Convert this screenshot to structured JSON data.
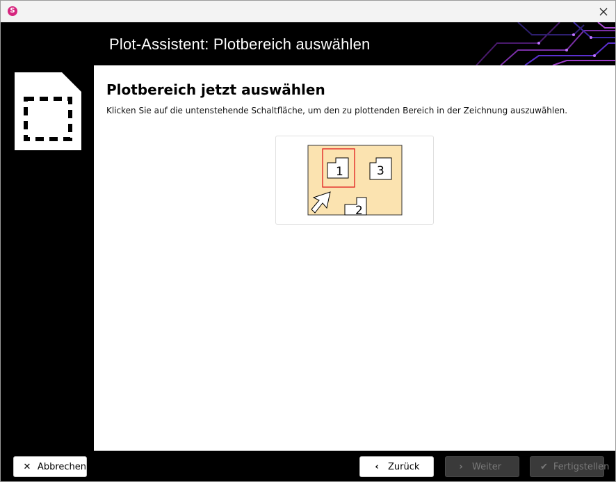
{
  "titlebar": {
    "app_icon_letter": "S",
    "close_icon": "close-icon"
  },
  "header": {
    "title": "Plot-Assistent: Plotbereich auswählen"
  },
  "sidebar": {
    "icon": "document-selection-icon"
  },
  "content": {
    "heading": "Plotbereich jetzt auswählen",
    "description": "Klicken Sie auf die untenstehende Schaltfläche, um den zu plottenden Bereich in der Zeichnung auszuwählen.",
    "illustration": {
      "labels": [
        "1",
        "3",
        "2"
      ],
      "selected_label": "1",
      "icon": "select-plot-area-illustration"
    }
  },
  "footer": {
    "cancel": {
      "label": "Abbrechen",
      "icon": "x-icon",
      "enabled": true
    },
    "back": {
      "label": "Zurück",
      "icon": "chevron-left-icon",
      "enabled": true
    },
    "next": {
      "label": "Weiter",
      "icon": "chevron-right-icon",
      "enabled": false
    },
    "finish": {
      "label": "Fertigstellen",
      "icon": "checkmark-icon",
      "enabled": false
    }
  },
  "colors": {
    "accent": "#d6257e",
    "illustration_bg": "#fbe3b0",
    "selection": "#e01b1b",
    "header_bg": "#000000"
  }
}
